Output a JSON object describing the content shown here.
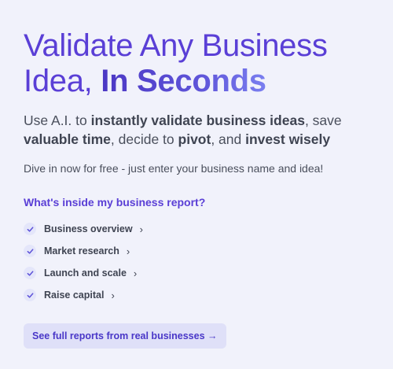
{
  "hero": {
    "title_line1": "Validate Any Business",
    "title_line2_plain": "Idea, ",
    "title_line2_bold": "In Seconds",
    "lead": {
      "t1": "Use A.I. to ",
      "b1": "instantly validate business ideas",
      "t2": ", save ",
      "b2": "valuable time",
      "t3": ", decide to ",
      "b3": "pivot",
      "t4": ", and ",
      "b4": "invest wisely"
    },
    "subtext": "Dive in now for free - just enter your business name and idea!"
  },
  "report": {
    "heading": "What's inside my business report?",
    "items": [
      {
        "label": "Business overview",
        "icon": "checkmark-icon"
      },
      {
        "label": "Market research",
        "icon": "checkmark-icon"
      },
      {
        "label": "Launch and scale",
        "icon": "checkmark-icon"
      },
      {
        "label": "Raise capital",
        "icon": "checkmark-icon"
      }
    ]
  },
  "cta": {
    "label": "See full reports from real businesses →"
  },
  "colors": {
    "background": "#f1f2fb",
    "accent": "#5a3fd6",
    "text": "#3f4452",
    "button_bg": "#dfe0f8"
  }
}
